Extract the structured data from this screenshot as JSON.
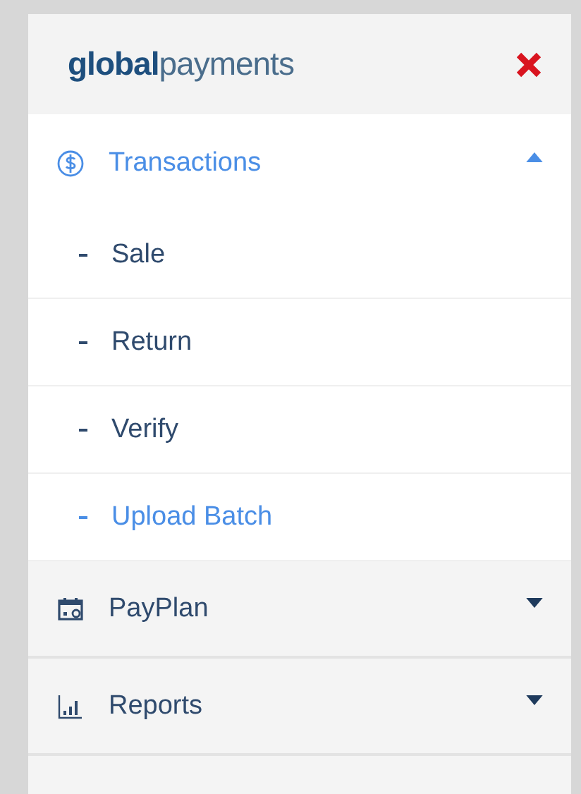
{
  "header": {
    "logo": "**global**payments"
  },
  "menu": [
    {
      "label": "Transactions",
      "expanded": true,
      "children": [
        {
          "label": "Sale",
          "selected": false
        },
        {
          "label": "Return",
          "selected": false
        },
        {
          "label": "Verify",
          "selected": false
        },
        {
          "label": "Upload Batch",
          "selected": true
        }
      ]
    },
    {
      "label": "PayPlan",
      "expanded": false
    },
    {
      "label": "Reports",
      "expanded": false
    }
  ]
}
